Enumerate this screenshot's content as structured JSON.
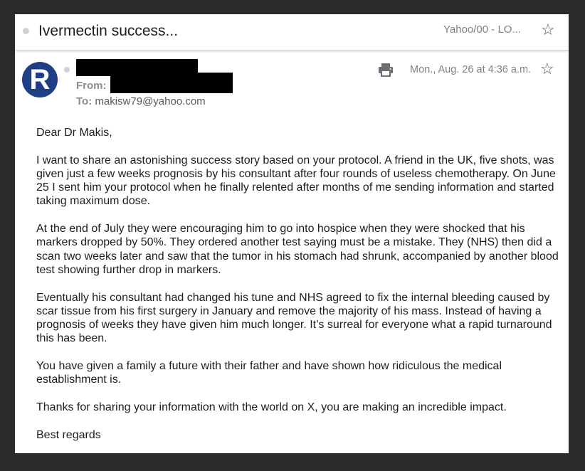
{
  "subject_bar": {
    "title": "Ivermectin success...",
    "folder": "Yahoo/00 - LO...",
    "star_icon": "star-outline-icon"
  },
  "message_header": {
    "avatar_letter": "R",
    "avatar_color": "#1e3f85",
    "from_label": "From:",
    "to_label": "To:",
    "to_address": "makisw79@yahoo.com",
    "date": "Mon., Aug. 26 at 4:36 a.m.",
    "print_icon": "printer-icon",
    "star_icon": "star-outline-icon"
  },
  "body": {
    "paragraphs": [
      "Dear Dr Makis,",
      "I want to share an astonishing success story based on your protocol.  A friend in the UK, five shots, was given just a few weeks prognosis by his consultant after four rounds of useless chemotherapy.  On June 25 I sent him your protocol when he finally relented after months of me sending information and started taking maximum dose.",
      "At the end of July they were encouraging him to go into hospice when they were shocked that his markers dropped by 50%.  They ordered another test saying must be a mistake.  They (NHS) then did a scan two weeks later and saw that the tumor in his stomach had shrunk, accompanied by another blood test showing further drop in markers.",
      "Eventually his consultant had changed his tune and NHS agreed to fix the internal bleeding caused by scar tissue from his first surgery in January and remove the majority of his mass. Instead of having a prognosis of weeks they have given him much longer.  It’s surreal for everyone what a rapid turnaround this has been.",
      "You have given a family a future with their father and have shown how ridiculous the medical establishment is.",
      "Thanks for sharing your information with the world on X, you are making an incredible impact.",
      "Best regards"
    ]
  }
}
